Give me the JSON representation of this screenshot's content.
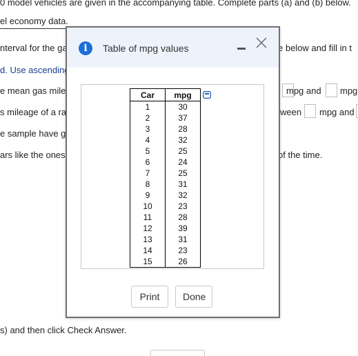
{
  "background": {
    "lines": [
      "0 model vehicles are given in the accompanying table. Complete parts (a) and (b) below.",
      "el economy data.",
      "nterval for the ga",
      "e below and fill in t",
      "d. Use ascending",
      "e mean gas mile",
      "mpg and",
      "mpg",
      "s mileage of a ra",
      "ween",
      "mpg and",
      "e sample have g",
      "ars like the ones",
      "of the time.",
      "s) and then click Check Answer."
    ]
  },
  "dialog": {
    "title": "Table of mpg values",
    "info_icon": "info-icon",
    "accent_color": "#1c6fd6",
    "table": {
      "headers": [
        "Car",
        "mpg"
      ],
      "rows": [
        [
          "1",
          "30"
        ],
        [
          "2",
          "37"
        ],
        [
          "3",
          "28"
        ],
        [
          "4",
          "32"
        ],
        [
          "5",
          "25"
        ],
        [
          "6",
          "24"
        ],
        [
          "7",
          "25"
        ],
        [
          "8",
          "31"
        ],
        [
          "9",
          "32"
        ],
        [
          "10",
          "23"
        ],
        [
          "11",
          "28"
        ],
        [
          "12",
          "39"
        ],
        [
          "13",
          "31"
        ],
        [
          "14",
          "23"
        ],
        [
          "15",
          "26"
        ]
      ]
    },
    "buttons": {
      "print": "Print",
      "done": "Done"
    }
  }
}
